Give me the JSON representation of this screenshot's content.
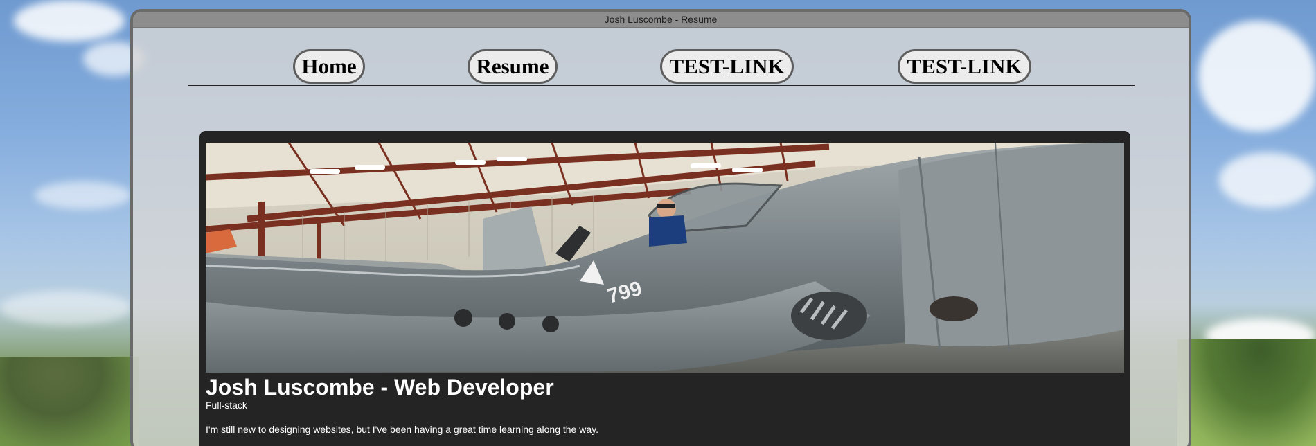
{
  "window": {
    "title": "Josh Luscombe - Resume"
  },
  "nav": {
    "items": [
      {
        "label": "Home"
      },
      {
        "label": "Resume"
      },
      {
        "label": "TEST-LINK"
      },
      {
        "label": "TEST-LINK"
      }
    ]
  },
  "hero": {
    "image_description_icon": "photo-icon",
    "aircraft_number": "799",
    "title": "Josh Luscombe - Web Developer",
    "subtitle": "Full-stack",
    "body": "I'm still new to designing websites, but I've been having a great time learning along the way."
  },
  "colors": {
    "frame_border": "#6a6a6a",
    "card_background": "#242424",
    "nav_button_fill": "#ececec",
    "nav_button_border": "#5e5e5e"
  }
}
